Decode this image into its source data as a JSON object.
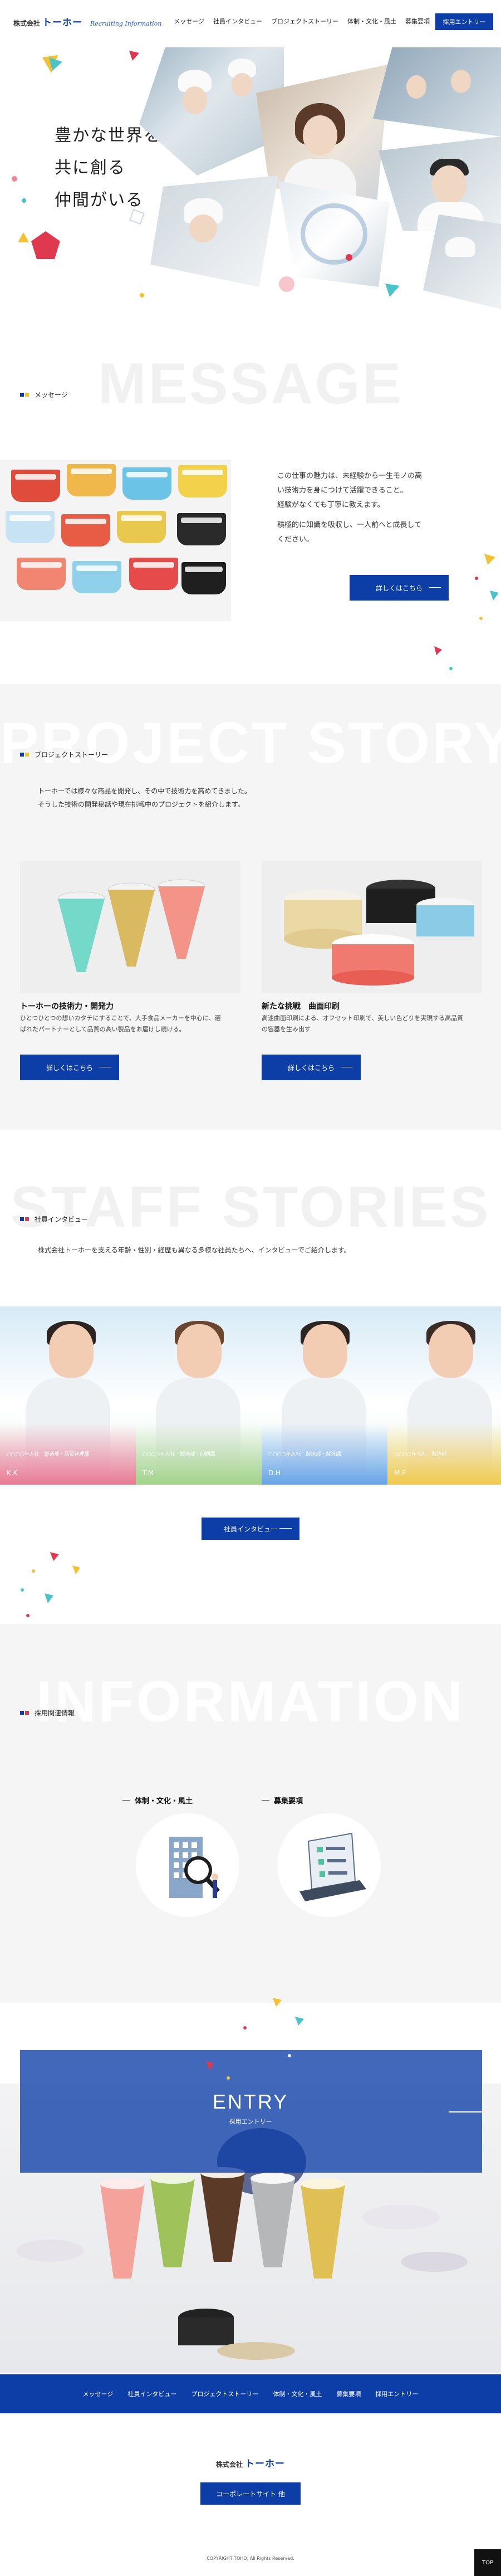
{
  "header": {
    "logo_corp": "株式会社",
    "logo_name": "トーホー",
    "logo_sub": "Recruiting Information",
    "nav": [
      "メッセージ",
      "社員インタビュー",
      "プロジェクトストーリー",
      "体制・文化・風土",
      "募集要項"
    ],
    "entry": "採用エントリー"
  },
  "hero": {
    "copy": [
      "豊かな世界を",
      "共に創る",
      "仲間がいる"
    ]
  },
  "message": {
    "big": "MESSAGE",
    "label": "メッセージ",
    "text": [
      "この仕事の魅力は、未経験から一生モノの高",
      "い技術力を身につけて活躍できること。",
      "経験がなくても丁寧に教えます。",
      "",
      "積極的に知識を吸収し、一人前へと成長して",
      "ください。"
    ],
    "button": "詳しくはこちら"
  },
  "project": {
    "big": "PROJECT STORY",
    "label": "プロジェクトストーリー",
    "intro": [
      "トーホーでは様々な商品を開発し、その中で技術力を高めてきました。",
      "そうした技術の開発秘話や現在挑戦中のプロジェクトを紹介します。"
    ],
    "cards": [
      {
        "title": "トーホーの技術力・開発力",
        "text": [
          "ひとつひとつの想いカタチにすることで、大手食品メーカーを中心に、選",
          "ばれたパートナーとして品質の高い製品をお届けし続ける。"
        ],
        "button": "詳しくはこちら"
      },
      {
        "title": "新たな挑戦　曲面印刷",
        "text": [
          "高速曲面印刷による、オフセット印刷で、美しい色どりを実現する高品質",
          "の容器を生み出す"
        ],
        "button": "詳しくはこちら"
      }
    ]
  },
  "staff": {
    "big": "STAFF STORIES",
    "label": "社員インタビュー",
    "intro": "株式会社トーホーを支える年齢・性別・経歴も異なる多様な社員たちへ、インタビューでご紹介します。",
    "cards": [
      {
        "meta": "○○○○年入社　製造部・品質管理課",
        "name": "K.K"
      },
      {
        "meta": "○○○○年入社　製造部・印刷課",
        "name": "T.M"
      },
      {
        "meta": "○○○○年入社　製造部・製造課",
        "name": "D.H"
      },
      {
        "meta": "○○○○年入社　製造部",
        "name": "M.F"
      }
    ],
    "button": "社員インタビュー"
  },
  "information": {
    "big": "INFORMATION",
    "label": "採用関連情報",
    "items": [
      "体制・文化・風土",
      "募集要項"
    ]
  },
  "entry": {
    "title": "ENTRY",
    "sub": "採用エントリー"
  },
  "footer": {
    "nav": [
      "メッセージ",
      "社員インタビュー",
      "プロジェクトストーリー",
      "体制・文化・風土",
      "募集要項",
      "採用エントリー"
    ],
    "corp_button": "コーポレートサイト 他",
    "copyright": "COPYRIGHT TOHO, All Rights Reserved.",
    "pagetop": "TOP"
  },
  "colors": {
    "brand": "#0d3ea8",
    "accent_yellow": "#f2c230",
    "accent_red": "#e0384f",
    "accent_teal": "#4cc3c8"
  }
}
